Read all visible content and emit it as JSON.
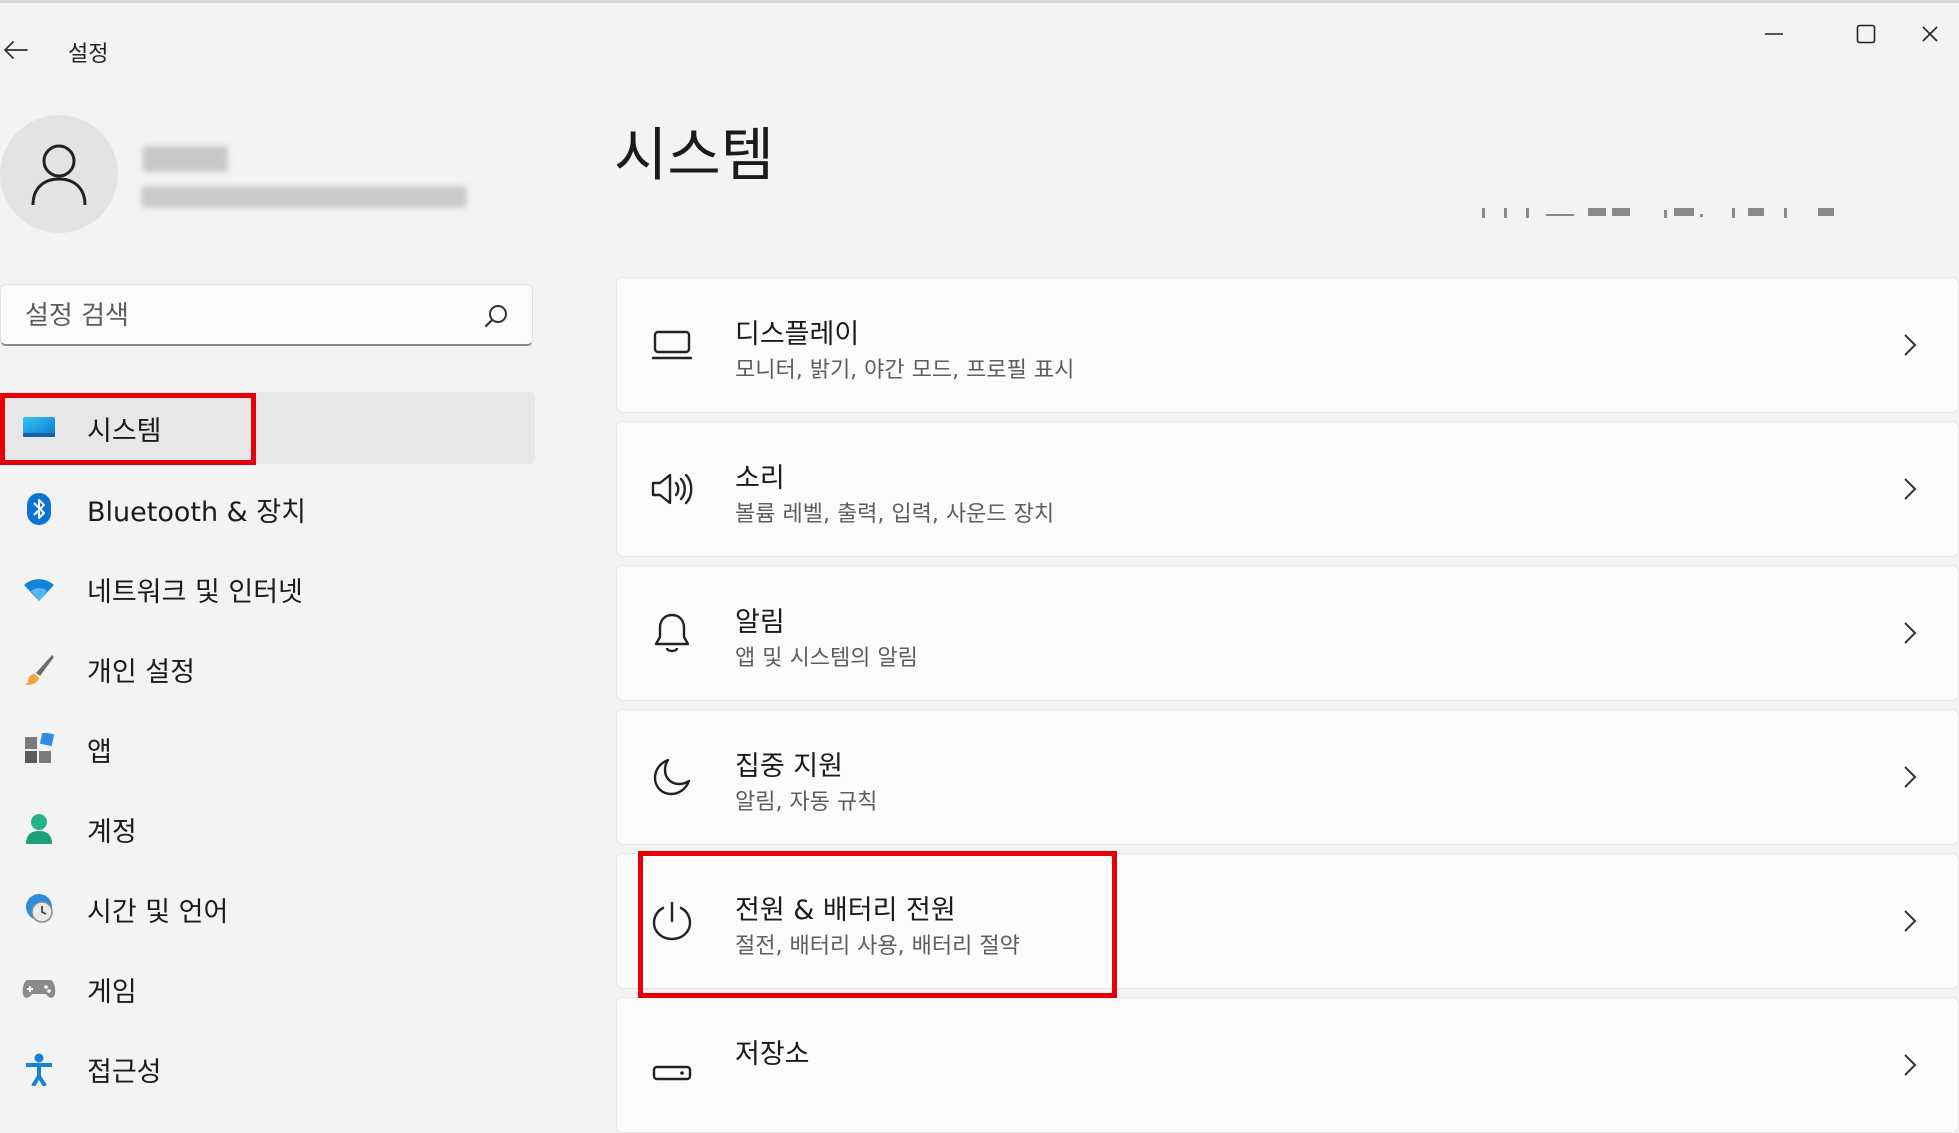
{
  "window": {
    "title": "설정"
  },
  "profile": {
    "name": "",
    "email": ""
  },
  "search": {
    "placeholder": "설정 검색"
  },
  "sidebar": {
    "items": [
      {
        "label": "시스템",
        "icon": "system-monitor-icon",
        "active": true
      },
      {
        "label": "Bluetooth & 장치",
        "icon": "bluetooth-icon"
      },
      {
        "label": "네트워크 및 인터넷",
        "icon": "wifi-icon"
      },
      {
        "label": "개인 설정",
        "icon": "paintbrush-icon"
      },
      {
        "label": "앱",
        "icon": "apps-icon"
      },
      {
        "label": "계정",
        "icon": "account-icon"
      },
      {
        "label": "시간 및 언어",
        "icon": "globe-clock-icon"
      },
      {
        "label": "게임",
        "icon": "gamepad-icon"
      },
      {
        "label": "접근성",
        "icon": "accessibility-icon"
      }
    ]
  },
  "main": {
    "title": "시스템",
    "cards": [
      {
        "title": "디스플레이",
        "subtitle": "모니터, 밝기, 야간 모드, 프로필 표시",
        "icon": "display-icon"
      },
      {
        "title": "소리",
        "subtitle": "볼륨 레벨, 출력, 입력, 사운드 장치",
        "icon": "speaker-icon"
      },
      {
        "title": "알림",
        "subtitle": "앱 및 시스템의 알림",
        "icon": "bell-icon"
      },
      {
        "title": "집중 지원",
        "subtitle": "알림, 자동 규칙",
        "icon": "moon-icon"
      },
      {
        "title": "전원 & 배터리 전원",
        "subtitle": "절전, 배터리 사용, 배터리 절약",
        "icon": "power-icon"
      },
      {
        "title": "저장소",
        "subtitle": "",
        "icon": "storage-icon"
      }
    ]
  },
  "colors": {
    "background": "#f3f3f3",
    "card": "#fbfbfb",
    "accent": "#0067c0",
    "annotation_red": "#e6000a"
  }
}
